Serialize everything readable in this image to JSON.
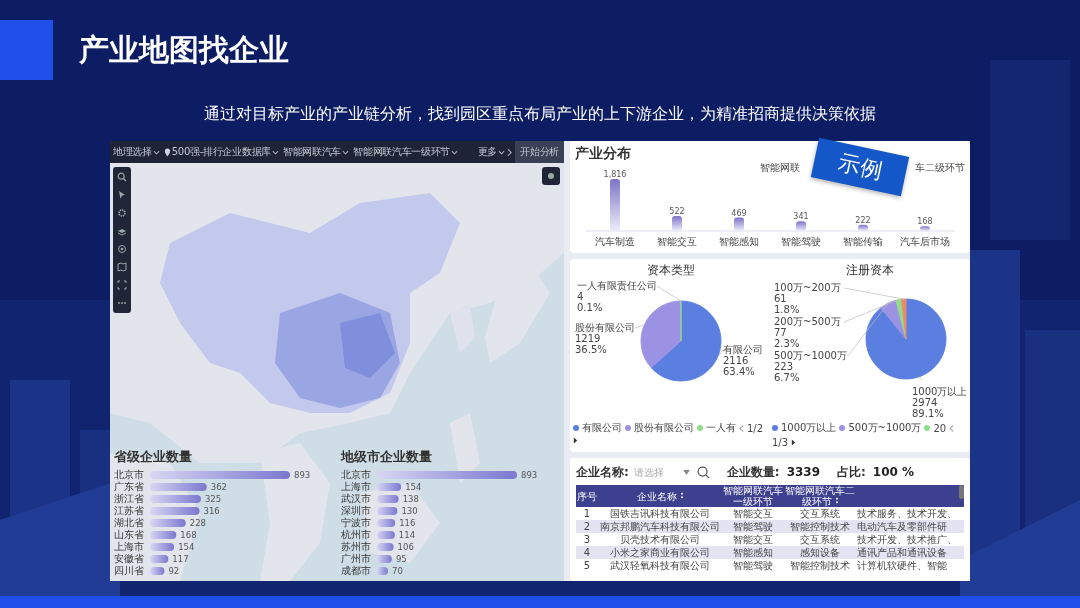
{
  "slide": {
    "title": "产业地图找企业",
    "subtitle": "通过对目标产业的产业链分析，找到园区重点布局产业的上下游企业，为精准招商提供决策依据"
  },
  "map_panel": {
    "toolbar": [
      {
        "label": "地理选择",
        "kind": "dropdown"
      },
      {
        "label": "500强-排行企业数据库",
        "kind": "source"
      },
      {
        "label": "智能网联汽车",
        "kind": "dropdown"
      },
      {
        "label": "智能网联汽车一级环节",
        "kind": "dropdown"
      },
      {
        "label": "更多",
        "kind": "more"
      },
      {
        "label": "开始分析",
        "kind": "action"
      }
    ],
    "province_ranking": {
      "chart_data": {
        "type": "bar",
        "orientation": "horizontal",
        "title": "省级企业数量",
        "categories": [
          "北京市",
          "广东省",
          "浙江省",
          "江苏省",
          "湖北省",
          "山东省",
          "上海市",
          "安徽省",
          "四川省"
        ],
        "values": [
          893,
          362,
          325,
          316,
          228,
          168,
          154,
          117,
          92
        ],
        "data_labels": true
      }
    },
    "city_ranking": {
      "chart_data": {
        "type": "bar",
        "orientation": "horizontal",
        "title": "地级市企业数量",
        "categories": [
          "北京市",
          "上海市",
          "武汉市",
          "深圳市",
          "宁波市",
          "杭州市",
          "苏州市",
          "广州市",
          "成都市"
        ],
        "values": [
          893,
          154,
          138,
          130,
          116,
          114,
          106,
          95,
          70
        ],
        "data_labels": true
      }
    }
  },
  "industry_distribution": {
    "legend_fragments": [
      "智能网联",
      "车二级环节"
    ],
    "stamp": "示例",
    "chart_data": {
      "type": "bar",
      "title": "产业分布",
      "categories": [
        "汽车制造",
        "智能交互",
        "智能感知",
        "智能驾驶",
        "智能传输",
        "汽车后市场"
      ],
      "values": [
        1816,
        522,
        469,
        341,
        222,
        168
      ],
      "value_labels": [
        "1,816",
        "522",
        "469",
        "341",
        "222",
        "168"
      ]
    }
  },
  "capital_type": {
    "chart_data": {
      "type": "pie",
      "title": "资本类型",
      "categories": [
        "一人有限责任公司",
        "股份有限公司",
        "有限公司"
      ],
      "values": [
        0.1,
        36.5,
        63.4
      ]
    },
    "slice_labels": [
      {
        "count": "4",
        "percent": "0.1%"
      },
      {
        "count": "1219",
        "percent": "36.5%"
      },
      {
        "count": "2116",
        "percent": "63.4%"
      }
    ],
    "legend": {
      "items": [
        "有限公司",
        "股份有限公司",
        "一人有"
      ],
      "page": "1/2"
    }
  },
  "registered_capital": {
    "chart_data": {
      "type": "pie",
      "title": "注册资本",
      "categories": [
        "100万~200万",
        "200万~500万",
        "500万~1000万",
        "1000万以上"
      ],
      "values": [
        1.8,
        2.3,
        6.7,
        89.1
      ]
    },
    "slice_labels": [
      {
        "count": "61",
        "percent": "1.8%"
      },
      {
        "count": "77",
        "percent": "2.3%"
      },
      {
        "count": "223",
        "percent": "6.7%"
      },
      {
        "count": "2974",
        "percent": "89.1%"
      }
    ],
    "legend": {
      "items": [
        "1000万以上",
        "500万~1000万",
        "20"
      ],
      "page": "1/3"
    }
  },
  "companies": {
    "filter_label": "企业名称:",
    "placeholder": "请选择",
    "count_label": "企业数量:",
    "count": "3339",
    "ratio_label": "占比:",
    "ratio": "100 %",
    "columns": [
      {
        "label": "序号",
        "sortable": false
      },
      {
        "label": "企业名称",
        "sortable": true
      },
      {
        "label": "智能网联汽车一级环节",
        "sortable": false
      },
      {
        "label": "智能网联汽车二级环节",
        "sortable": true
      }
    ],
    "rows": [
      [
        "1",
        "国铁吉讯科技有限公司",
        "智能交互",
        "交互系统",
        "技术服务、技术开发、"
      ],
      [
        "2",
        "南京邦鹏汽车科技有限公司",
        "智能驾驶",
        "智能控制技术",
        "电动汽车及零部件研"
      ],
      [
        "3",
        "贝壳技术有限公司",
        "智能交互",
        "交互系统",
        "技术开发、技术推广、"
      ],
      [
        "4",
        "小米之家商业有限公司",
        "智能感知",
        "感知设备",
        "通讯产品和通讯设备"
      ],
      [
        "5",
        "武汉轻氧科技有限公司",
        "智能驾驶",
        "智能控制技术",
        "计算机软硬件、智能"
      ]
    ]
  }
}
